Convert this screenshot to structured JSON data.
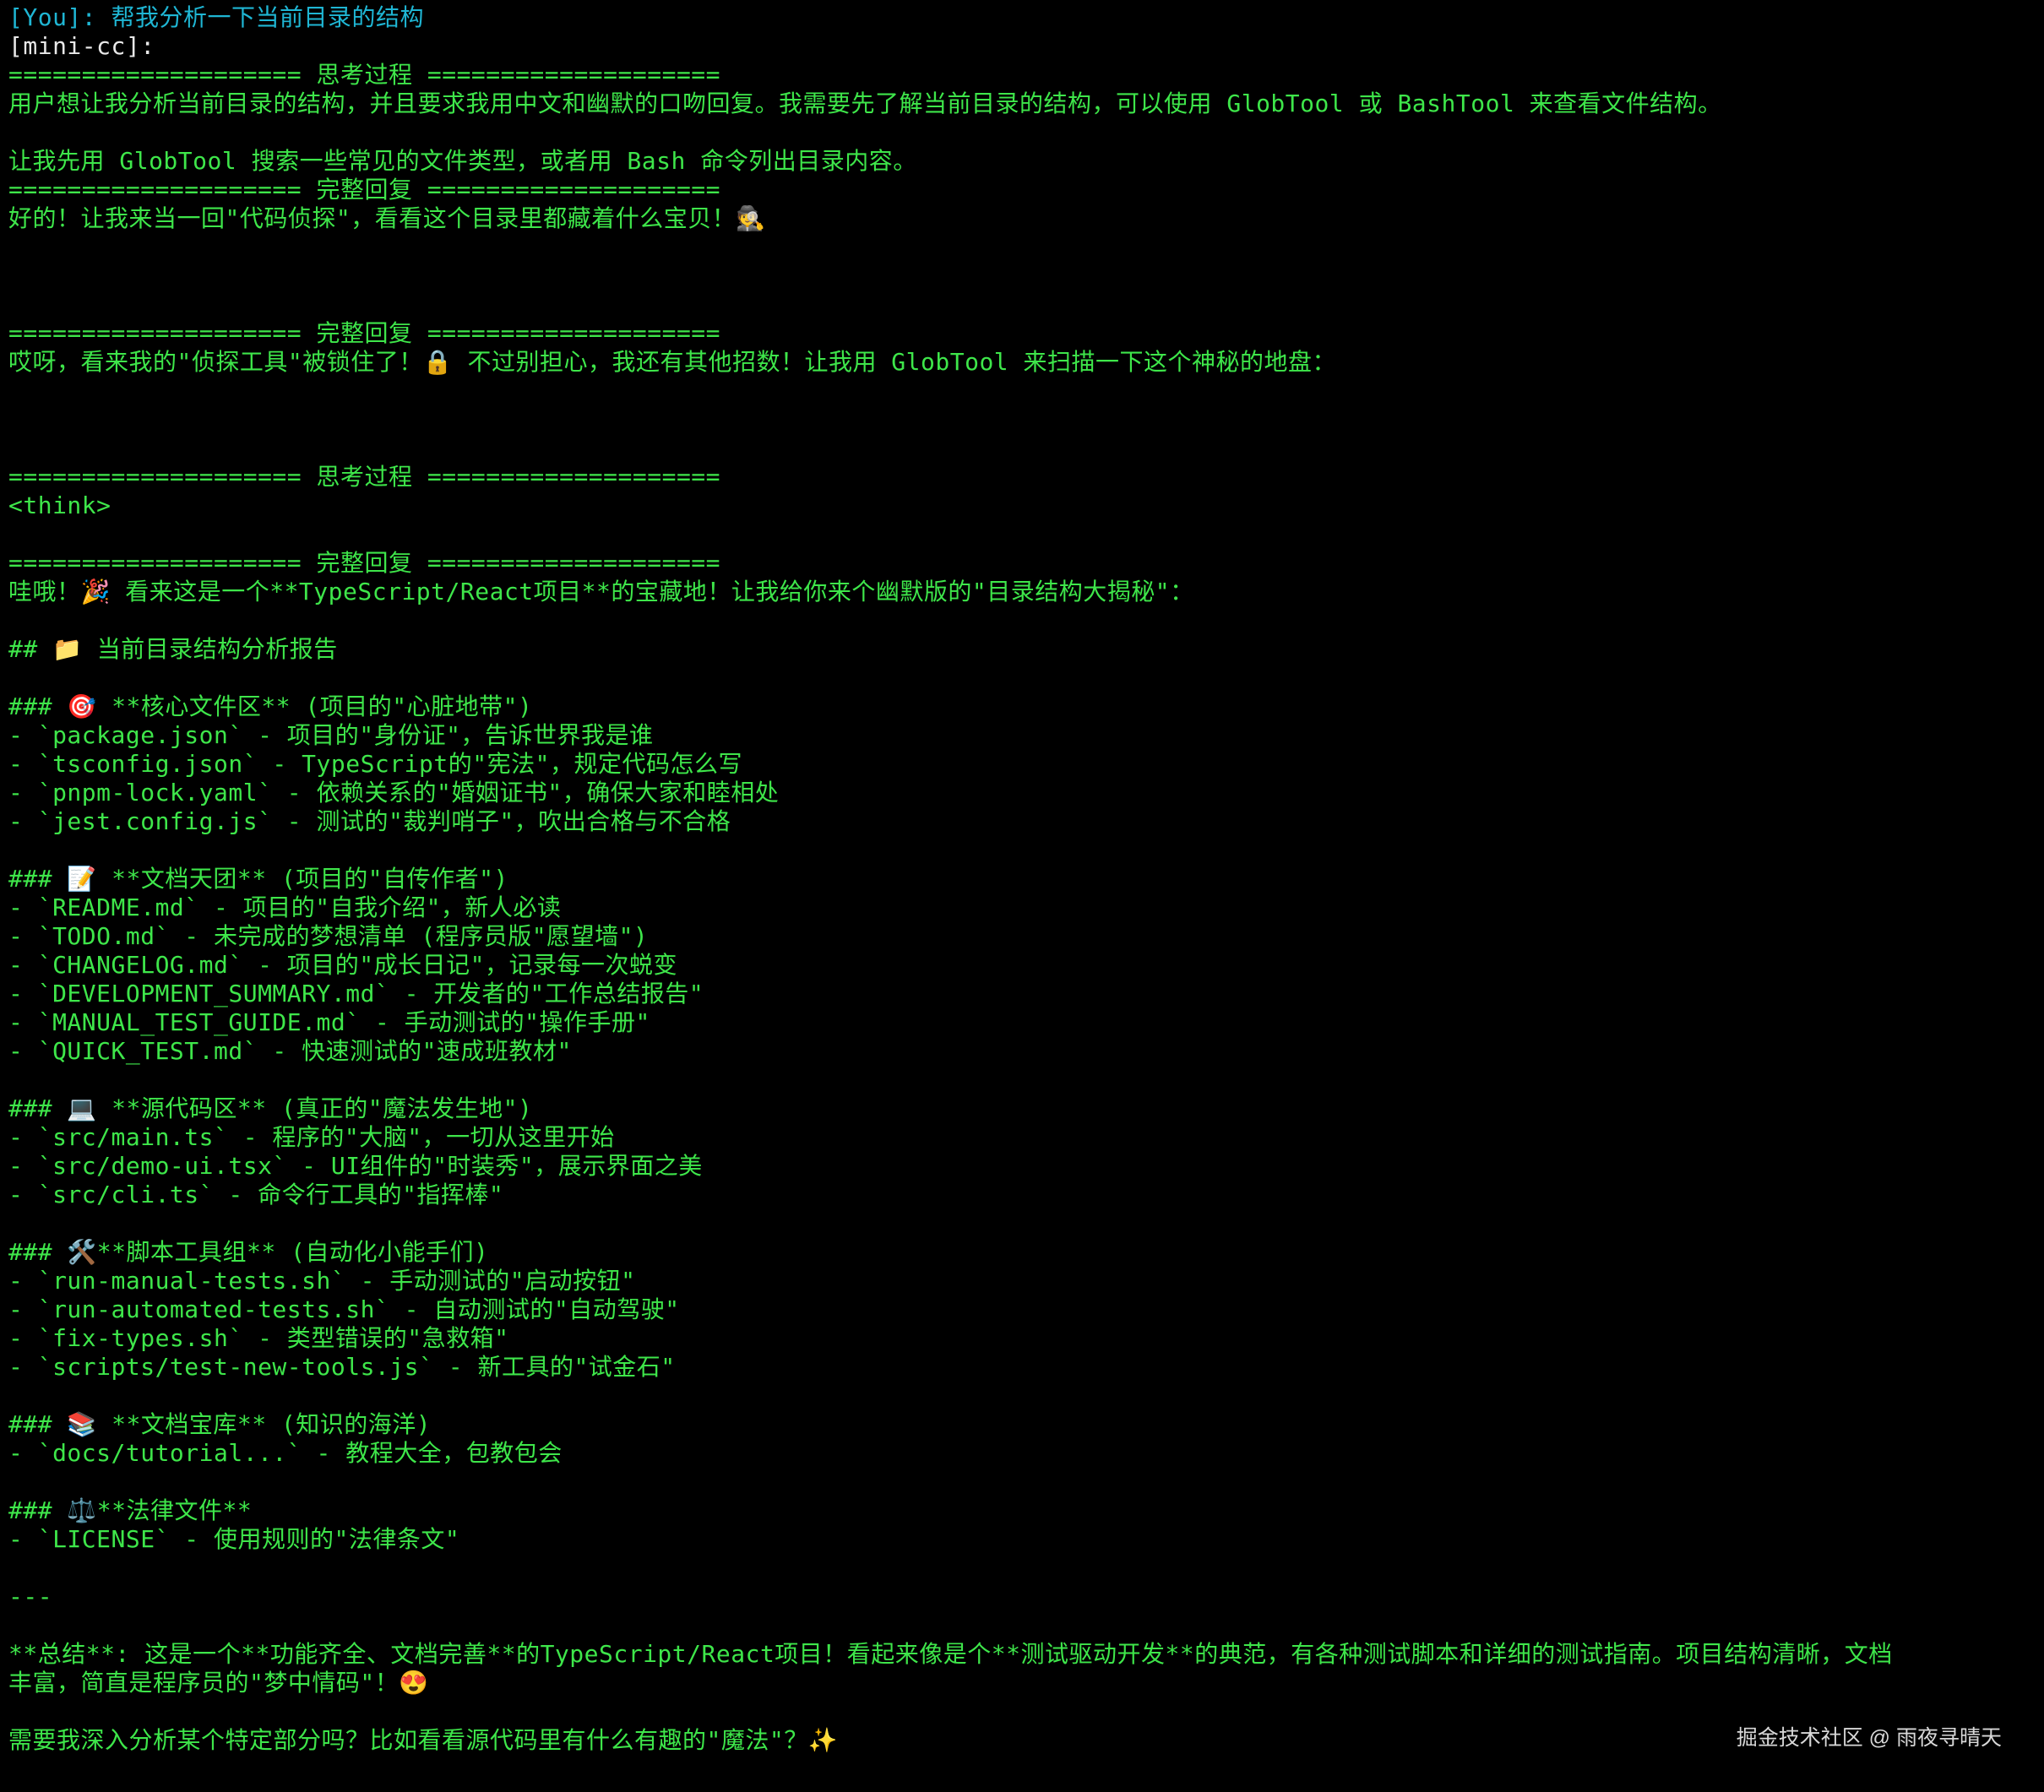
{
  "colors": {
    "background": "#000000",
    "user_prompt": "#1fb6d4",
    "assistant_label": "#e8e8e8",
    "assistant_text": "#3ee64a",
    "watermark": "#d8d8d8"
  },
  "terminal": {
    "lines": [
      {
        "text": "[You]: 帮我分析一下当前目录的结构",
        "kind": "user"
      },
      {
        "text": "[mini-cc]:",
        "kind": "plain"
      },
      {
        "text": "==================== 思考过程 ====================",
        "kind": "green"
      },
      {
        "text": "用户想让我分析当前目录的结构，并且要求我用中文和幽默的口吻回复。我需要先了解当前目录的结构，可以使用 GlobTool 或 BashTool 来查看文件结构。",
        "kind": "green"
      },
      {
        "text": "",
        "kind": "green"
      },
      {
        "text": "让我先用 GlobTool 搜索一些常见的文件类型，或者用 Bash 命令列出目录内容。",
        "kind": "green"
      },
      {
        "text": "==================== 完整回复 ====================",
        "kind": "green"
      },
      {
        "text": "好的！让我来当一回\"代码侦探\"，看看这个目录里都藏着什么宝贝！🕵️",
        "kind": "green"
      },
      {
        "text": "",
        "kind": "green"
      },
      {
        "text": "",
        "kind": "green"
      },
      {
        "text": "",
        "kind": "green"
      },
      {
        "text": "==================== 完整回复 ====================",
        "kind": "green"
      },
      {
        "text": "哎呀，看来我的\"侦探工具\"被锁住了！🔒 不过别担心，我还有其他招数！让我用 GlobTool 来扫描一下这个神秘的地盘：",
        "kind": "green"
      },
      {
        "text": "",
        "kind": "green"
      },
      {
        "text": "",
        "kind": "green"
      },
      {
        "text": "",
        "kind": "green"
      },
      {
        "text": "==================== 思考过程 ====================",
        "kind": "green"
      },
      {
        "text": "<think>",
        "kind": "green"
      },
      {
        "text": "",
        "kind": "green"
      },
      {
        "text": "==================== 完整回复 ====================",
        "kind": "green"
      },
      {
        "text": "哇哦！🎉 看来这是一个**TypeScript/React项目**的宝藏地！让我给你来个幽默版的\"目录结构大揭秘\"：",
        "kind": "green"
      },
      {
        "text": "",
        "kind": "green"
      },
      {
        "text": "## 📁 当前目录结构分析报告",
        "kind": "green"
      },
      {
        "text": "",
        "kind": "green"
      },
      {
        "text": "### 🎯 **核心文件区** (项目的\"心脏地带\")",
        "kind": "green"
      },
      {
        "text": "- `package.json` - 项目的\"身份证\"，告诉世界我是谁",
        "kind": "green"
      },
      {
        "text": "- `tsconfig.json` - TypeScript的\"宪法\"，规定代码怎么写",
        "kind": "green"
      },
      {
        "text": "- `pnpm-lock.yaml` - 依赖关系的\"婚姻证书\"，确保大家和睦相处",
        "kind": "green"
      },
      {
        "text": "- `jest.config.js` - 测试的\"裁判哨子\"，吹出合格与不合格",
        "kind": "green"
      },
      {
        "text": "",
        "kind": "green"
      },
      {
        "text": "### 📝 **文档天团** (项目的\"自传作者\")",
        "kind": "green"
      },
      {
        "text": "- `README.md` - 项目的\"自我介绍\"，新人必读",
        "kind": "green"
      },
      {
        "text": "- `TODO.md` - 未完成的梦想清单 (程序员版\"愿望墙\")",
        "kind": "green"
      },
      {
        "text": "- `CHANGELOG.md` - 项目的\"成长日记\"，记录每一次蜕变",
        "kind": "green"
      },
      {
        "text": "- `DEVELOPMENT_SUMMARY.md` - 开发者的\"工作总结报告\"",
        "kind": "green"
      },
      {
        "text": "- `MANUAL_TEST_GUIDE.md` - 手动测试的\"操作手册\"",
        "kind": "green"
      },
      {
        "text": "- `QUICK_TEST.md` - 快速测试的\"速成班教材\"",
        "kind": "green"
      },
      {
        "text": "",
        "kind": "green"
      },
      {
        "text": "### 💻 **源代码区** (真正的\"魔法发生地\")",
        "kind": "green"
      },
      {
        "text": "- `src/main.ts` - 程序的\"大脑\"，一切从这里开始",
        "kind": "green"
      },
      {
        "text": "- `src/demo-ui.tsx` - UI组件的\"时装秀\"，展示界面之美",
        "kind": "green"
      },
      {
        "text": "- `src/cli.ts` - 命令行工具的\"指挥棒\"",
        "kind": "green"
      },
      {
        "text": "",
        "kind": "green"
      },
      {
        "text": "### 🛠️**脚本工具组** (自动化小能手们)",
        "kind": "green"
      },
      {
        "text": "- `run-manual-tests.sh` - 手动测试的\"启动按钮\"",
        "kind": "green"
      },
      {
        "text": "- `run-automated-tests.sh` - 自动测试的\"自动驾驶\"",
        "kind": "green"
      },
      {
        "text": "- `fix-types.sh` - 类型错误的\"急救箱\"",
        "kind": "green"
      },
      {
        "text": "- `scripts/test-new-tools.js` - 新工具的\"试金石\"",
        "kind": "green"
      },
      {
        "text": "",
        "kind": "green"
      },
      {
        "text": "### 📚 **文档宝库** (知识的海洋)",
        "kind": "green"
      },
      {
        "text": "- `docs/tutorial...` - 教程大全，包教包会",
        "kind": "green"
      },
      {
        "text": "",
        "kind": "green"
      },
      {
        "text": "### ⚖️**法律文件**",
        "kind": "green"
      },
      {
        "text": "- `LICENSE` - 使用规则的\"法律条文\"",
        "kind": "green"
      },
      {
        "text": "",
        "kind": "green"
      },
      {
        "text": "---",
        "kind": "green"
      },
      {
        "text": "",
        "kind": "green"
      },
      {
        "text": "**总结**: 这是一个**功能齐全、文档完善**的TypeScript/React项目！看起来像是个**测试驱动开发**的典范，有各种测试脚本和详细的测试指南。项目结构清晰，文档",
        "kind": "green"
      },
      {
        "text": "丰富，简直是程序员的\"梦中情码\"！😍",
        "kind": "green"
      },
      {
        "text": "",
        "kind": "green"
      },
      {
        "text": "需要我深入分析某个特定部分吗？比如看看源代码里有什么有趣的\"魔法\"？✨",
        "kind": "green"
      }
    ]
  },
  "watermark": {
    "text": "掘金技术社区 @ 雨夜寻晴天"
  }
}
